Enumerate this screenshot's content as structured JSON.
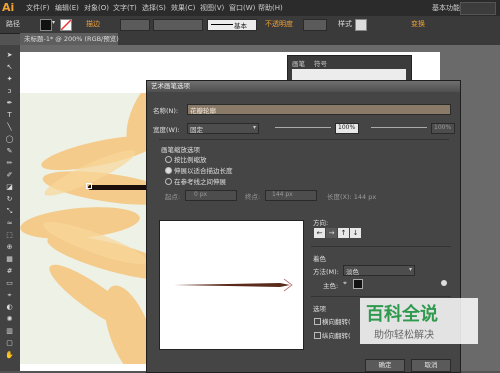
{
  "app": {
    "logo": "Ai"
  },
  "menubar": {
    "items": [
      "文件(F)",
      "编辑(E)",
      "对象(O)",
      "文字(T)",
      "选择(S)",
      "效果(C)",
      "视图(V)",
      "窗口(W)",
      "帮助(H)"
    ],
    "workspace": "基本功能"
  },
  "control_bar": {
    "path_label": "路径",
    "stroke_label": "描边",
    "stroke_style": "基本",
    "opacity_label": "不透明度",
    "style_label": "样式",
    "transform_label": "变换"
  },
  "document": {
    "tab_title": "未标题-1* @ 200% (RGB/预览)"
  },
  "swatch_panel": {
    "tabs": [
      "画笔",
      "符号"
    ]
  },
  "dialog": {
    "title": "艺术画笔选项",
    "name_label": "名称(N):",
    "name_value": "花瓣轮廓",
    "width_label": "宽度(W):",
    "width_mode": "固定",
    "width_pct_1": "100%",
    "width_pct_2": "100%",
    "scale_group": "画笔缩放选项",
    "scale_options": [
      "按比例缩放",
      "伸展以适合描边长度",
      "在参考线之间伸展"
    ],
    "start_label": "起点:",
    "start_value": "0 px",
    "end_label": "终点:",
    "end_value": "144 px",
    "length_label": "长度(X): 144 px",
    "direction_label": "方向:",
    "direction_icons": [
      "arrow-left-icon",
      "arrow-right-icon",
      "arrow-up-icon",
      "arrow-down-icon"
    ],
    "coloring_label": "着色",
    "method_label": "方法(M):",
    "method_value": "淡色",
    "key_color_label": "主色:",
    "options_label": "选项",
    "flip_along": "横向翻转(",
    "flip_across": "纵向翻转(",
    "ok": "确定",
    "cancel": "取消"
  },
  "watermark": {
    "title": "百科全说",
    "subtitle": "助你轻松解决"
  },
  "colors": {
    "accent": "#f0a035",
    "dialog_bg": "#454545",
    "menubar_bg": "#2b2b2b",
    "stroke_brown": "#5a2a1a"
  }
}
